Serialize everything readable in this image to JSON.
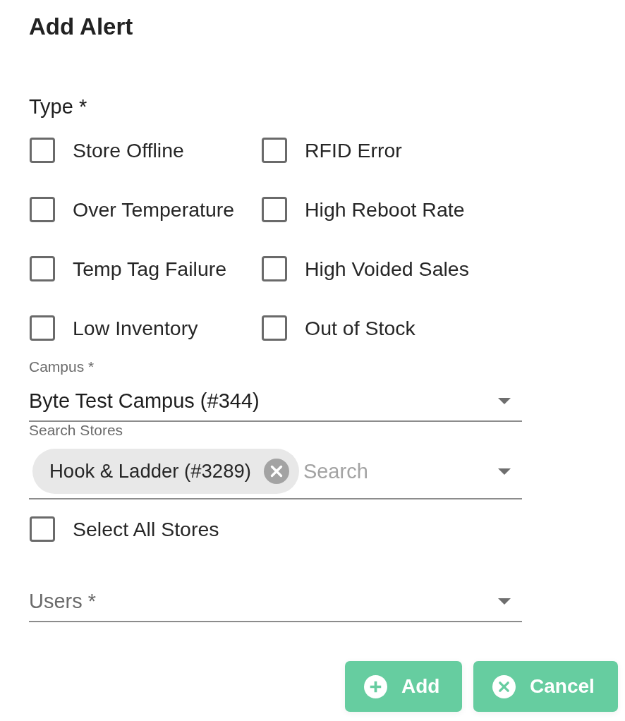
{
  "dialog": {
    "title": "Add Alert"
  },
  "type_field": {
    "label": "Type *",
    "options": [
      {
        "label": "Store Offline",
        "checked": false
      },
      {
        "label": "RFID Error",
        "checked": false
      },
      {
        "label": "Over Temperature",
        "checked": false
      },
      {
        "label": "High Reboot Rate",
        "checked": false
      },
      {
        "label": "Temp Tag Failure",
        "checked": false
      },
      {
        "label": "High Voided Sales",
        "checked": false
      },
      {
        "label": "Low Inventory",
        "checked": false
      },
      {
        "label": "Out of Stock",
        "checked": false
      }
    ]
  },
  "campus": {
    "label": "Campus *",
    "value": "Byte Test Campus (#344)"
  },
  "stores": {
    "label": "Search Stores",
    "chips": [
      {
        "label": "Hook & Ladder (#3289)"
      }
    ],
    "placeholder": "Search"
  },
  "select_all": {
    "label": "Select All Stores",
    "checked": false
  },
  "users": {
    "label": "Users *"
  },
  "buttons": [
    {
      "label": "Add",
      "kind": "add"
    },
    {
      "label": "Cancel",
      "kind": "cancel"
    }
  ]
}
